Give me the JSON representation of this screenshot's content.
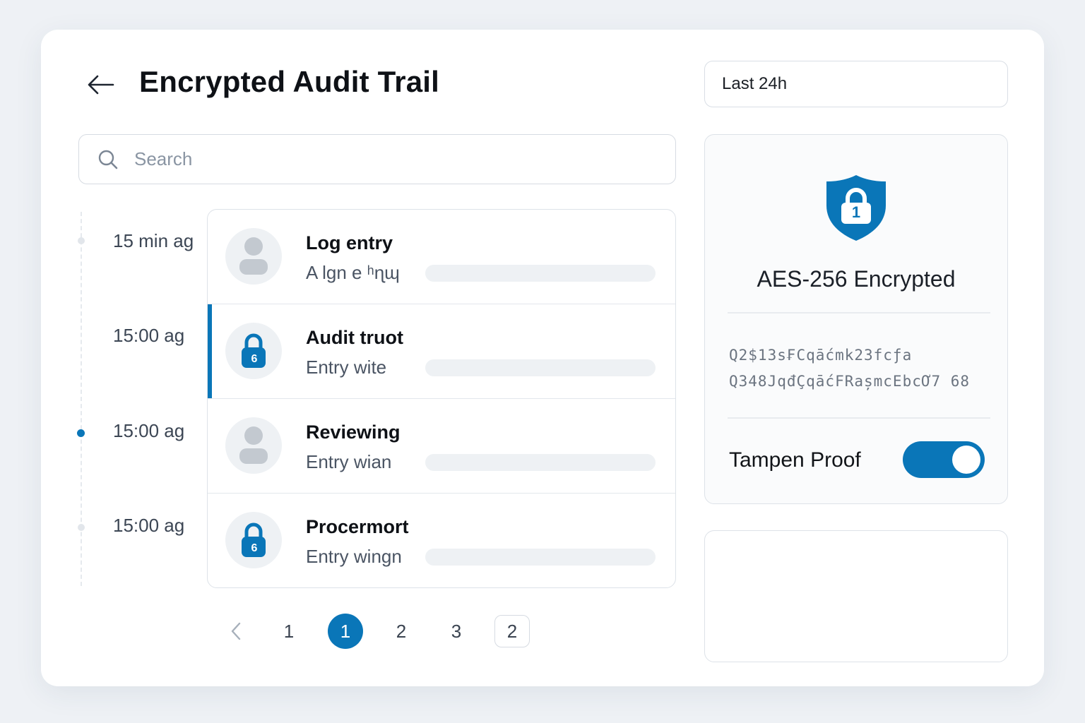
{
  "header": {
    "title": "Encrypted Audit Trail",
    "time_range": "Last 24h"
  },
  "search": {
    "placeholder": "Search",
    "value": ""
  },
  "timeline": [
    {
      "time": "15 min ag",
      "active": false
    },
    {
      "time": "15:00 ag",
      "active": false
    },
    {
      "time": "15:00 ag",
      "active": true
    },
    {
      "time": "15:00 ag",
      "active": false
    }
  ],
  "entries": [
    {
      "title": "Log entry",
      "subtitle": "A lgn e ʰɳɰ",
      "icon": "user-icon",
      "selected": false
    },
    {
      "title": "Audit truot",
      "subtitle": "Entry wite",
      "icon": "lock-icon",
      "lock_number": "6",
      "selected": true
    },
    {
      "title": "Reviewing",
      "subtitle": "Entry wian",
      "icon": "user-icon",
      "selected": false
    },
    {
      "title": "Procermort",
      "subtitle": "Entry wingn",
      "icon": "lock-icon",
      "lock_number": "6",
      "selected": false
    }
  ],
  "pagination": {
    "prev_icon": "chevron-left-icon",
    "pages": [
      "1",
      "1",
      "2",
      "3",
      "2"
    ],
    "current_index": 1
  },
  "encryption": {
    "shield_number": "1",
    "title": "AES-256 Encrypted",
    "cipher_lines": [
      "Q2$13s₣Cqāćmk23fcƒa",
      "Q348JqđÇqāćFRașmcEbcƠ7 68"
    ],
    "tamper_label": "Tampen Proof",
    "tamper_enabled": true
  },
  "colors": {
    "accent": "#0a76b8",
    "background": "#eef1f5"
  }
}
